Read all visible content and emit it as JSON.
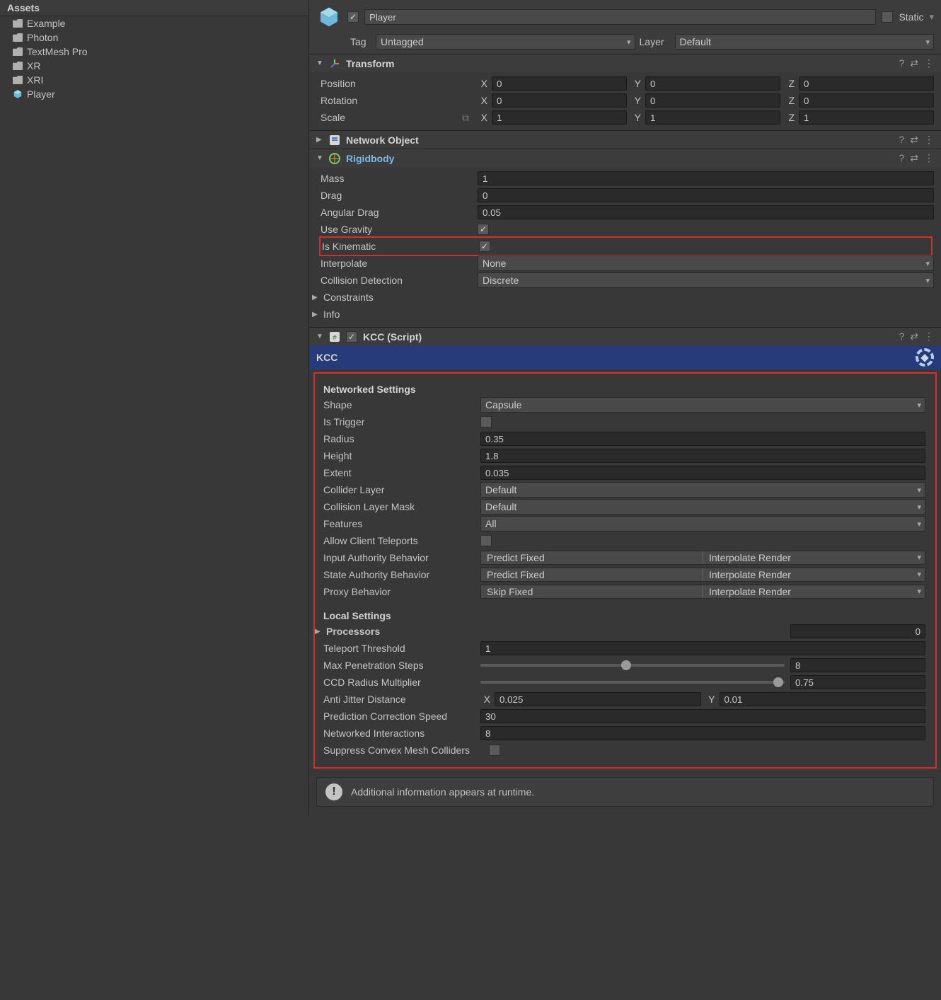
{
  "assets": {
    "title": "Assets",
    "items": [
      {
        "name": "Example",
        "type": "folder"
      },
      {
        "name": "Photon",
        "type": "folder"
      },
      {
        "name": "TextMesh Pro",
        "type": "folder"
      },
      {
        "name": "XR",
        "type": "folder"
      },
      {
        "name": "XRI",
        "type": "folder"
      },
      {
        "name": "Player",
        "type": "prefab"
      }
    ]
  },
  "inspector": {
    "name": "Player",
    "enabled": true,
    "static_label": "Static",
    "static": false,
    "tag_label": "Tag",
    "tag_value": "Untagged",
    "layer_label": "Layer",
    "layer_value": "Default"
  },
  "transform": {
    "title": "Transform",
    "position_label": "Position",
    "position": {
      "x": "0",
      "y": "0",
      "z": "0"
    },
    "rotation_label": "Rotation",
    "rotation": {
      "x": "0",
      "y": "0",
      "z": "0"
    },
    "scale_label": "Scale",
    "scale": {
      "x": "1",
      "y": "1",
      "z": "1"
    }
  },
  "network_object": {
    "title": "Network Object"
  },
  "rigidbody": {
    "title": "Rigidbody",
    "mass_label": "Mass",
    "mass": "1",
    "drag_label": "Drag",
    "drag": "0",
    "angular_drag_label": "Angular Drag",
    "angular_drag": "0.05",
    "use_gravity_label": "Use Gravity",
    "use_gravity": true,
    "is_kinematic_label": "Is Kinematic",
    "is_kinematic": true,
    "interpolate_label": "Interpolate",
    "interpolate": "None",
    "collision_detection_label": "Collision Detection",
    "collision_detection": "Discrete",
    "constraints_label": "Constraints",
    "info_label": "Info"
  },
  "kcc": {
    "title": "KCC (Script)",
    "bar_title": "KCC",
    "enabled": true,
    "networked_title": "Networked Settings",
    "shape_label": "Shape",
    "shape": "Capsule",
    "is_trigger_label": "Is Trigger",
    "is_trigger": false,
    "radius_label": "Radius",
    "radius": "0.35",
    "height_label": "Height",
    "height": "1.8",
    "extent_label": "Extent",
    "extent": "0.035",
    "collider_layer_label": "Collider Layer",
    "collider_layer": "Default",
    "collision_layer_mask_label": "Collision Layer Mask",
    "collision_layer_mask": "Default",
    "features_label": "Features",
    "features": "All",
    "allow_client_teleports_label": "Allow Client Teleports",
    "allow_client_teleports": false,
    "input_auth_label": "Input Authority Behavior",
    "input_auth_a": "Predict Fixed",
    "input_auth_b": "Interpolate Render",
    "state_auth_label": "State Authority Behavior",
    "state_auth_a": "Predict Fixed",
    "state_auth_b": "Interpolate Render",
    "proxy_label": "Proxy Behavior",
    "proxy_a": "Skip Fixed",
    "proxy_b": "Interpolate Render",
    "local_title": "Local Settings",
    "processors_label": "Processors",
    "processors": "0",
    "teleport_threshold_label": "Teleport Threshold",
    "teleport_threshold": "1",
    "max_pen_label": "Max Penetration Steps",
    "max_pen": "8",
    "ccd_label": "CCD Radius Multiplier",
    "ccd": "0.75",
    "anti_jitter_label": "Anti Jitter Distance",
    "anti_jitter": {
      "x": "0.025",
      "y": "0.01"
    },
    "pred_corr_label": "Prediction Correction Speed",
    "pred_corr": "30",
    "net_inter_label": "Networked Interactions",
    "net_inter": "8",
    "suppress_label": "Suppress Convex Mesh Colliders",
    "suppress": false
  },
  "runtime_info": "Additional information appears at runtime."
}
